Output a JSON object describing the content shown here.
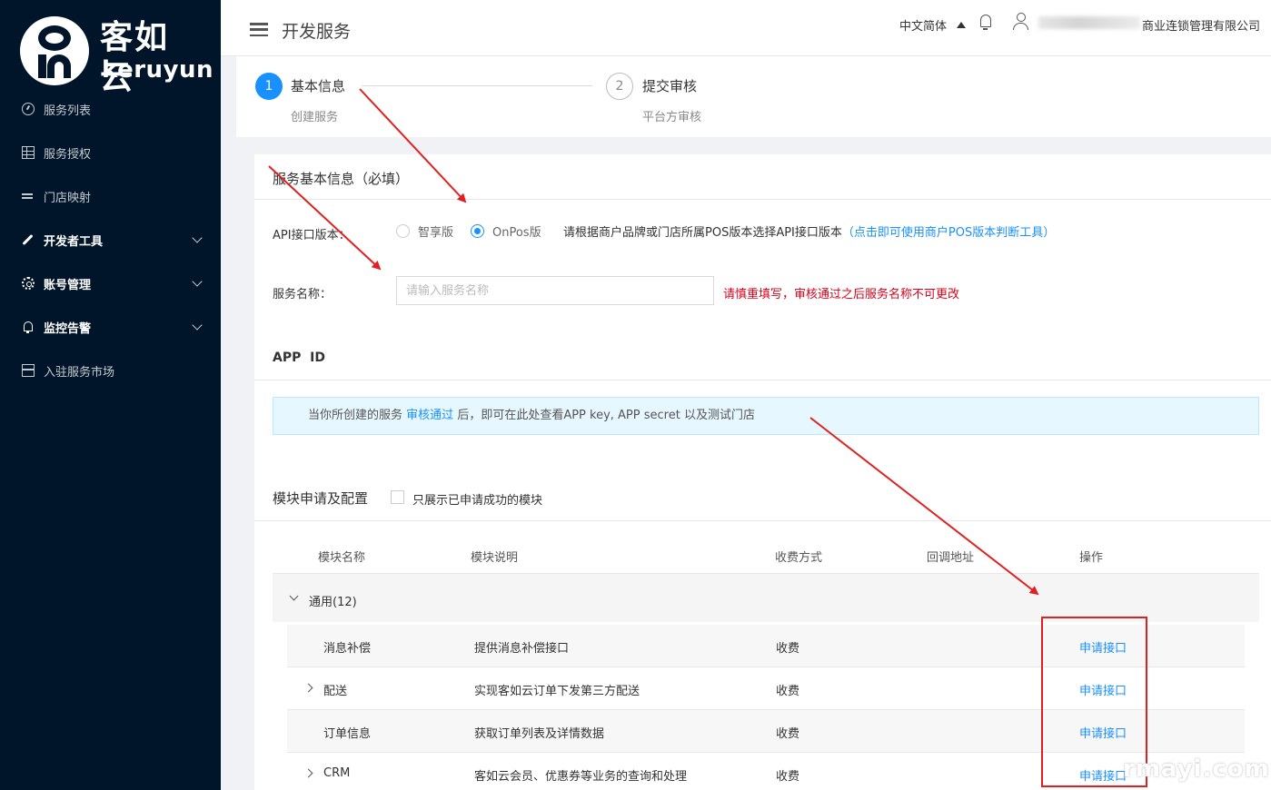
{
  "sidebar": {
    "logo_cn": "客如云",
    "logo_en": "keruyun",
    "items": [
      {
        "label": "服务列表"
      },
      {
        "label": "服务授权"
      },
      {
        "label": "门店映射"
      },
      {
        "label": "开发者工具"
      },
      {
        "label": "账号管理"
      },
      {
        "label": "监控告警"
      },
      {
        "label": "入驻服务市场"
      }
    ]
  },
  "header": {
    "title": "开发服务",
    "language": "中文简体",
    "company": "商业连锁管理有限公司"
  },
  "steps": [
    {
      "number": "1",
      "title": "基本信息",
      "desc": "创建服务"
    },
    {
      "number": "2",
      "title": "提交审核",
      "desc": "平台方审核"
    }
  ],
  "form": {
    "section_title": "服务基本信息（必填）",
    "api_label": "API接口版本：",
    "radio_options": [
      "智享版",
      "OnPos版"
    ],
    "api_hint": "请根据商户品牌或门店所属POS版本选择API接口版本",
    "api_link": "（点击即可使用商户POS版本判断工具）",
    "name_label": "服务名称：",
    "name_placeholder": "请输入服务名称",
    "name_warning": "请慎重填写，审核通过之后服务名称不可更改"
  },
  "app_id": {
    "title": "APP  ID",
    "info_prefix": "当你所创建的服务",
    "info_link": "审核通过",
    "info_suffix": "后，即可在此处查看APP key, APP secret 以及测试门店"
  },
  "modules": {
    "title": "模块申请及配置",
    "filter_label": "只展示已申请成功的模块",
    "columns": [
      "模块名称",
      "模块说明",
      "收费方式",
      "回调地址",
      "操作"
    ],
    "group": "通用(12)",
    "rows": [
      {
        "name": "消息补偿",
        "desc": "提供消息补偿接口",
        "fee": "收费",
        "action": "申请接口"
      },
      {
        "name": "配送",
        "desc": "实现客如云订单下发第三方配送",
        "fee": "收费",
        "action": "申请接口"
      },
      {
        "name": "订单信息",
        "desc": "获取订单列表及详情数据",
        "fee": "收费",
        "action": "申请接口"
      },
      {
        "name": "CRM",
        "desc": "客如云会员、优惠券等业务的查询和处理",
        "fee": "收费",
        "action": "申请接口"
      }
    ]
  },
  "watermark": "rmayi.com",
  "colors": {
    "sidebar_bg": "#001529",
    "primary": "#1890ff",
    "warning": "#d9001b",
    "annotation": "#e02020"
  }
}
